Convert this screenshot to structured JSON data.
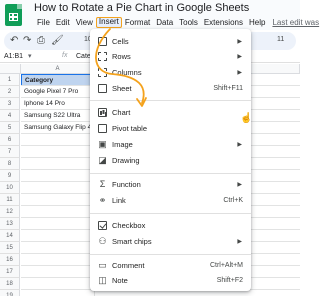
{
  "doc": {
    "title": "How to Rotate a Pie Chart in Google Sheets",
    "menus": [
      "File",
      "Edit",
      "View",
      "Insert",
      "Format",
      "Data",
      "Tools",
      "Extensions",
      "Help"
    ],
    "last_edit": "Last edit was"
  },
  "toolbar": {
    "undo_icon": "undo-icon",
    "redo_icon": "redo-icon",
    "print_icon": "print-icon",
    "paint_format_icon": "paint-format-icon",
    "zoom": "100",
    "font_size": "11"
  },
  "formula_bar": {
    "name_box": "A1:B1",
    "fx": "fx",
    "content": "Cate"
  },
  "grid": {
    "col_a": "A",
    "rows": [
      {
        "n": "1",
        "a": "Category"
      },
      {
        "n": "2",
        "a": "Google Pixel 7 Pro"
      },
      {
        "n": "3",
        "a": "Iphone 14 Pro"
      },
      {
        "n": "4",
        "a": "Samsung S22 Ultra"
      },
      {
        "n": "5",
        "a": "Samsung Galaxy Flip 4"
      },
      {
        "n": "6",
        "a": ""
      },
      {
        "n": "7",
        "a": ""
      },
      {
        "n": "8",
        "a": ""
      },
      {
        "n": "9",
        "a": ""
      },
      {
        "n": "10",
        "a": ""
      },
      {
        "n": "11",
        "a": ""
      },
      {
        "n": "12",
        "a": ""
      },
      {
        "n": "13",
        "a": ""
      },
      {
        "n": "14",
        "a": ""
      },
      {
        "n": "15",
        "a": ""
      },
      {
        "n": "16",
        "a": ""
      },
      {
        "n": "17",
        "a": ""
      },
      {
        "n": "18",
        "a": ""
      },
      {
        "n": "19",
        "a": ""
      }
    ]
  },
  "insert_menu": {
    "items": [
      {
        "label": "Cells",
        "icon": "cells-icon",
        "submenu": true
      },
      {
        "label": "Rows",
        "icon": "rows-icon",
        "submenu": true
      },
      {
        "label": "Columns",
        "icon": "columns-icon",
        "submenu": true
      },
      {
        "label": "Sheet",
        "icon": "sheet-icon",
        "shortcut": "Shift+F11"
      },
      {
        "label": "Chart",
        "icon": "chart-icon",
        "highlighted": true
      },
      {
        "label": "Pivot table",
        "icon": "pivot-table-icon"
      },
      {
        "label": "Image",
        "icon": "image-icon",
        "submenu": true
      },
      {
        "label": "Drawing",
        "icon": "drawing-icon"
      },
      {
        "label": "Function",
        "icon": "function-icon",
        "submenu": true
      },
      {
        "label": "Link",
        "icon": "link-icon",
        "shortcut": "Ctrl+K"
      },
      {
        "label": "Checkbox",
        "icon": "checkbox-icon"
      },
      {
        "label": "Smart chips",
        "icon": "smart-chips-icon",
        "submenu": true
      },
      {
        "label": "Comment",
        "icon": "comment-icon",
        "shortcut": "Ctrl+Alt+M"
      },
      {
        "label": "Note",
        "icon": "note-icon",
        "shortcut": "Shift+F2"
      }
    ]
  },
  "colors": {
    "accent": "#1a73e8",
    "annotation": "#f4a21c",
    "header_fill": "#bfd4ef",
    "sheets_green": "#0f9d58"
  }
}
